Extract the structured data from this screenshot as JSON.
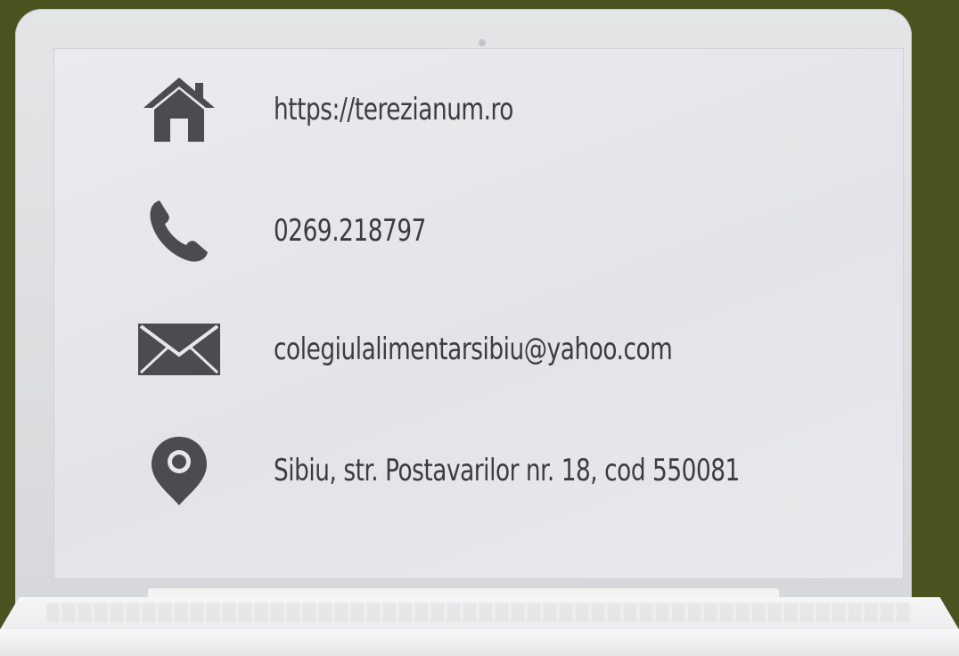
{
  "contact": {
    "website": "https://terezianum.ro",
    "phone": "0269.218797",
    "email": "colegiulalimentarsibiu@yahoo.com",
    "address": "Sibiu, str. Postavarilor nr. 18, cod 550081"
  },
  "icons": {
    "website": "home-icon",
    "phone": "phone-icon",
    "email": "envelope-icon",
    "address": "map-pin-icon"
  },
  "colors": {
    "background": "#4a5320",
    "screen": "#e6e7ea",
    "icon": "#4b4c50",
    "text": "#3b3c40"
  }
}
